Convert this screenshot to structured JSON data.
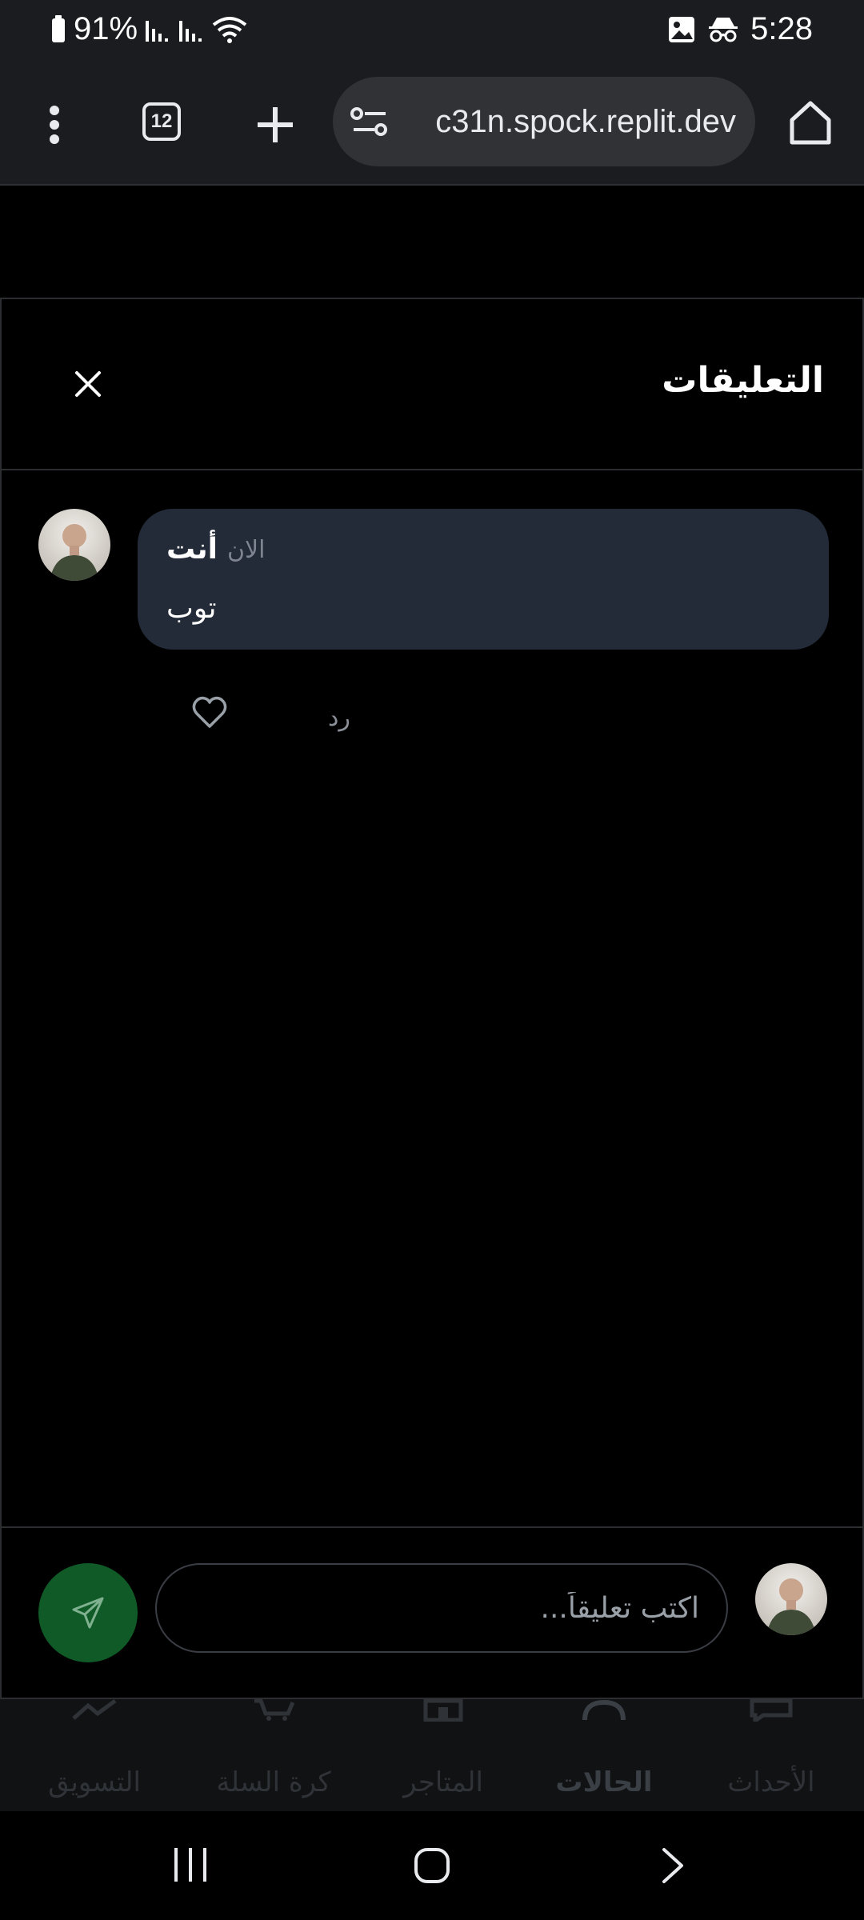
{
  "status_bar": {
    "battery": "91%",
    "time": "5:28"
  },
  "browser": {
    "tab_count": "12",
    "url": "c31n.spock.replit.dev"
  },
  "comments_sheet": {
    "title": "التعليقات",
    "comment": {
      "author": "أنت",
      "time": "الان",
      "text": "توب",
      "reply_label": "رد"
    },
    "input_placeholder": "اكتب تعليقاً..."
  },
  "app_nav": {
    "items": [
      {
        "label": "التسويق",
        "icon": "chart-icon"
      },
      {
        "label": "كرة السلة",
        "icon": "cart-icon"
      },
      {
        "label": "المتاجر",
        "icon": "store-icon"
      },
      {
        "label": "الحالات",
        "icon": "status-icon",
        "active": true
      },
      {
        "label": "الأحداث",
        "icon": "chat-icon"
      }
    ]
  },
  "colors": {
    "bubble": "#232a38",
    "send": "#0f5a26",
    "toolbar": "#1b1c20"
  }
}
